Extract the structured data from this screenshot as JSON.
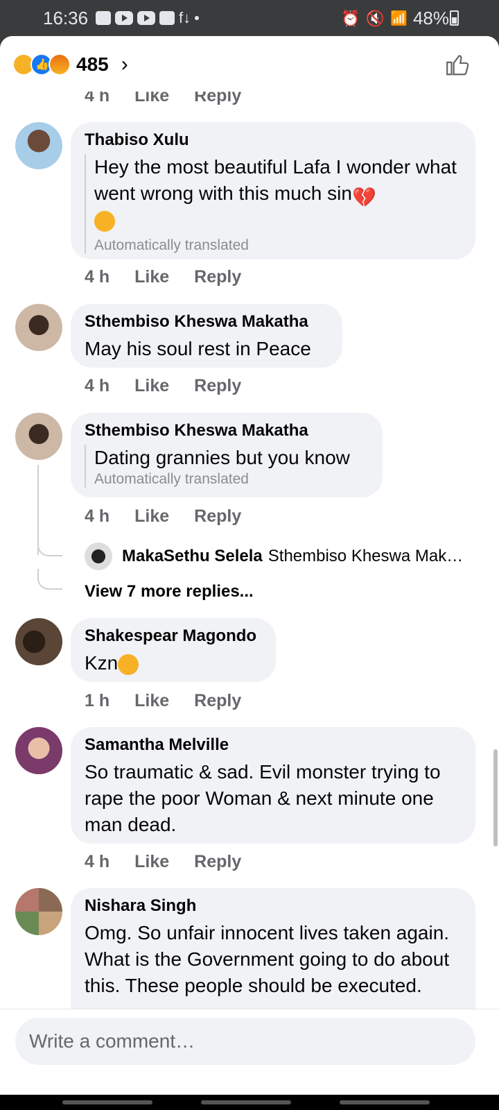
{
  "status_bar": {
    "time": "16:36",
    "battery": "48%"
  },
  "header": {
    "reaction_count": "485",
    "reactions": [
      "sad-reaction-icon",
      "like-reaction-icon",
      "angry-reaction-icon"
    ]
  },
  "partial_top": {
    "time": "4 h",
    "like": "Like",
    "reply": "Reply"
  },
  "comments": [
    {
      "name": "Thabiso Xulu",
      "text": "Hey the most beautiful Lafa I wonder what went wrong with this much sin",
      "note": "Automatically translated",
      "time": "4 h",
      "like": "Like",
      "reply": "Reply"
    },
    {
      "name": "Sthembiso Kheswa Makatha",
      "text": "May his soul rest in Peace",
      "time": "4 h",
      "like": "Like",
      "reply": "Reply"
    },
    {
      "name": "Sthembiso Kheswa Makatha",
      "text": "Dating grannies but you know",
      "note": "Automatically translated",
      "time": "4 h",
      "like": "Like",
      "reply": "Reply",
      "reply_preview": {
        "name": "MakaSethu Selela",
        "text": "Sthembiso Kheswa Mak…"
      },
      "view_more": "View 7 more replies..."
    },
    {
      "name": "Shakespear Magondo",
      "text": "Kzn",
      "time": "1 h",
      "like": "Like",
      "reply": "Reply"
    },
    {
      "name": "Samantha Melville",
      "text": "So traumatic & sad.  Evil monster trying to rape the poor Woman & next minute one man dead.",
      "time": "4 h",
      "like": "Like",
      "reply": "Reply"
    },
    {
      "name": "Nishara Singh",
      "text": "Omg. So unfair innocent lives taken again. What is the Government going to do about this. These people should be executed."
    }
  ],
  "composer": {
    "placeholder": "Write a comment…"
  }
}
